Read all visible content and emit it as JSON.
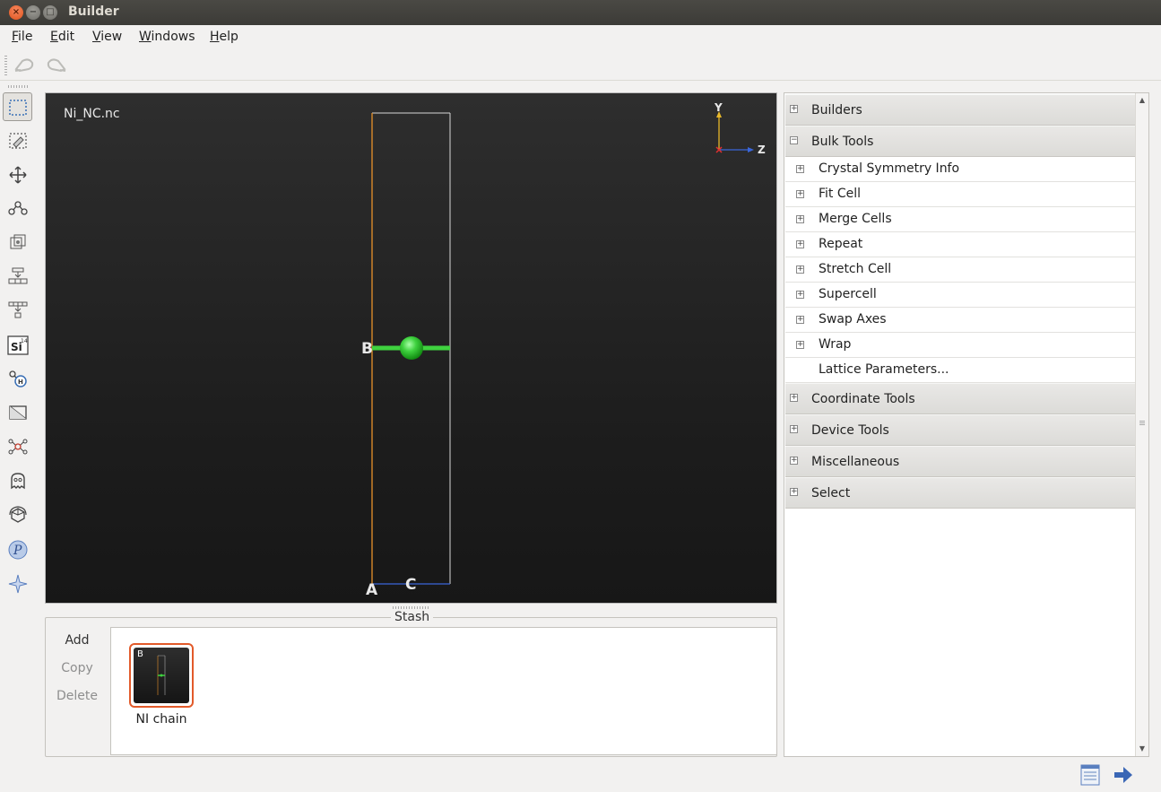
{
  "window": {
    "title": "Builder",
    "close_symbol": "×",
    "min_symbol": "−",
    "max_symbol": "□"
  },
  "menu": [
    "File",
    "Edit",
    "View",
    "Windows",
    "Help"
  ],
  "toolbar": {
    "undo_icon": "undo-icon",
    "redo_icon": "redo-icon"
  },
  "tools": [
    "rectangle-select-icon",
    "lasso-select-icon",
    "move-icon",
    "bond-icon",
    "cell-icon",
    "hierarchy-down-icon",
    "hierarchy-split-icon",
    "element-si-icon",
    "add-hydrogen-icon",
    "slice-icon",
    "molecule-icon",
    "ghost-icon",
    "rotate-cube-icon",
    "python-icon",
    "sparkle-icon"
  ],
  "element_tool": {
    "symbol": "Si",
    "number": "14"
  },
  "viewport": {
    "filename": "Ni_NC.nc",
    "cell_labels": {
      "a": "A",
      "b": "B",
      "c": "C"
    },
    "axes": {
      "y": "Y",
      "z": "Z"
    },
    "atom_color": "#3fd23f",
    "a_vector_color": "#e8912a",
    "c_vector_color": "#3a66d9"
  },
  "stash": {
    "title": "Stash",
    "actions": [
      {
        "label": "Add",
        "enabled": true
      },
      {
        "label": "Copy",
        "enabled": false
      },
      {
        "label": "Delete",
        "enabled": false
      }
    ],
    "items": [
      {
        "name": "NI chain",
        "thumb_label": "B",
        "selected": true
      }
    ]
  },
  "panel": {
    "groups": [
      {
        "label": "Builders",
        "expanded": false,
        "toggle": "+"
      },
      {
        "label": "Bulk Tools",
        "expanded": true,
        "toggle": "−",
        "children": [
          {
            "label": "Crystal Symmetry Info",
            "toggle": "+"
          },
          {
            "label": "Fit Cell",
            "toggle": "+"
          },
          {
            "label": "Merge Cells",
            "toggle": "+"
          },
          {
            "label": "Repeat",
            "toggle": "+"
          },
          {
            "label": "Stretch Cell",
            "toggle": "+"
          },
          {
            "label": "Supercell",
            "toggle": "+"
          },
          {
            "label": "Swap Axes",
            "toggle": "+"
          },
          {
            "label": "Wrap",
            "toggle": "+"
          },
          {
            "label": "Lattice Parameters...",
            "toggle": ""
          }
        ]
      },
      {
        "label": "Coordinate Tools",
        "expanded": false,
        "toggle": "+"
      },
      {
        "label": "Device Tools",
        "expanded": false,
        "toggle": "+"
      },
      {
        "label": "Miscellaneous",
        "expanded": false,
        "toggle": "+"
      },
      {
        "label": "Select",
        "expanded": false,
        "toggle": "+"
      }
    ],
    "scroll_up": "▲",
    "scroll_down": "▼"
  },
  "bottom_icons": [
    "document-list-icon",
    "send-arrow-icon"
  ]
}
